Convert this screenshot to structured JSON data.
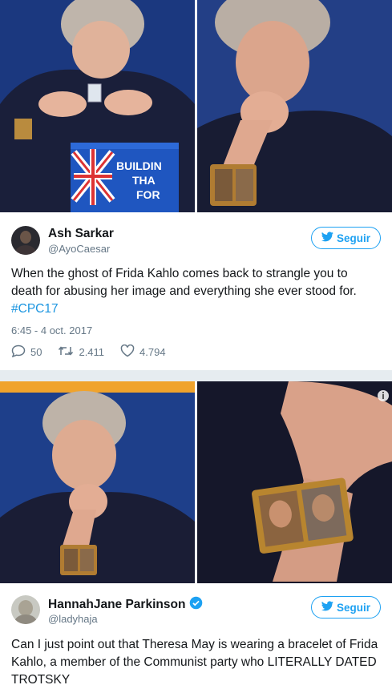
{
  "tweet1": {
    "name": "Ash Sarkar",
    "handle": "@AyoCaesar",
    "follow_label": "Seguir",
    "text": "When the ghost of Frida Kahlo comes back to strangle you to death for abusing her image and everything she ever stood for.",
    "hashtag": "#CPC17",
    "time": "6:45 - 4 oct. 2017",
    "replies": "50",
    "retweets": "2.411",
    "likes": "4.794",
    "podium_text": [
      "BUILDIN",
      "THA",
      "FOR"
    ]
  },
  "tweet2": {
    "name": "HannahJane Parkinson",
    "handle": "@ladyhaja",
    "follow_label": "Seguir",
    "text": "Can I just point out that Theresa May is wearing a bracelet of Frida Kahlo, a member of the Communist party who LITERALLY DATED TROTSKY"
  },
  "colors": {
    "accent": "#1da1f2",
    "link": "#1b95e0",
    "stage_blue": "#1e3f8a",
    "orange_stripe": "#f0a32c",
    "divider": "#e6ecf0"
  },
  "icons": [
    "twitter-bird-icon",
    "reply-icon",
    "retweet-icon",
    "like-icon",
    "verified-badge-icon",
    "info-icon"
  ]
}
